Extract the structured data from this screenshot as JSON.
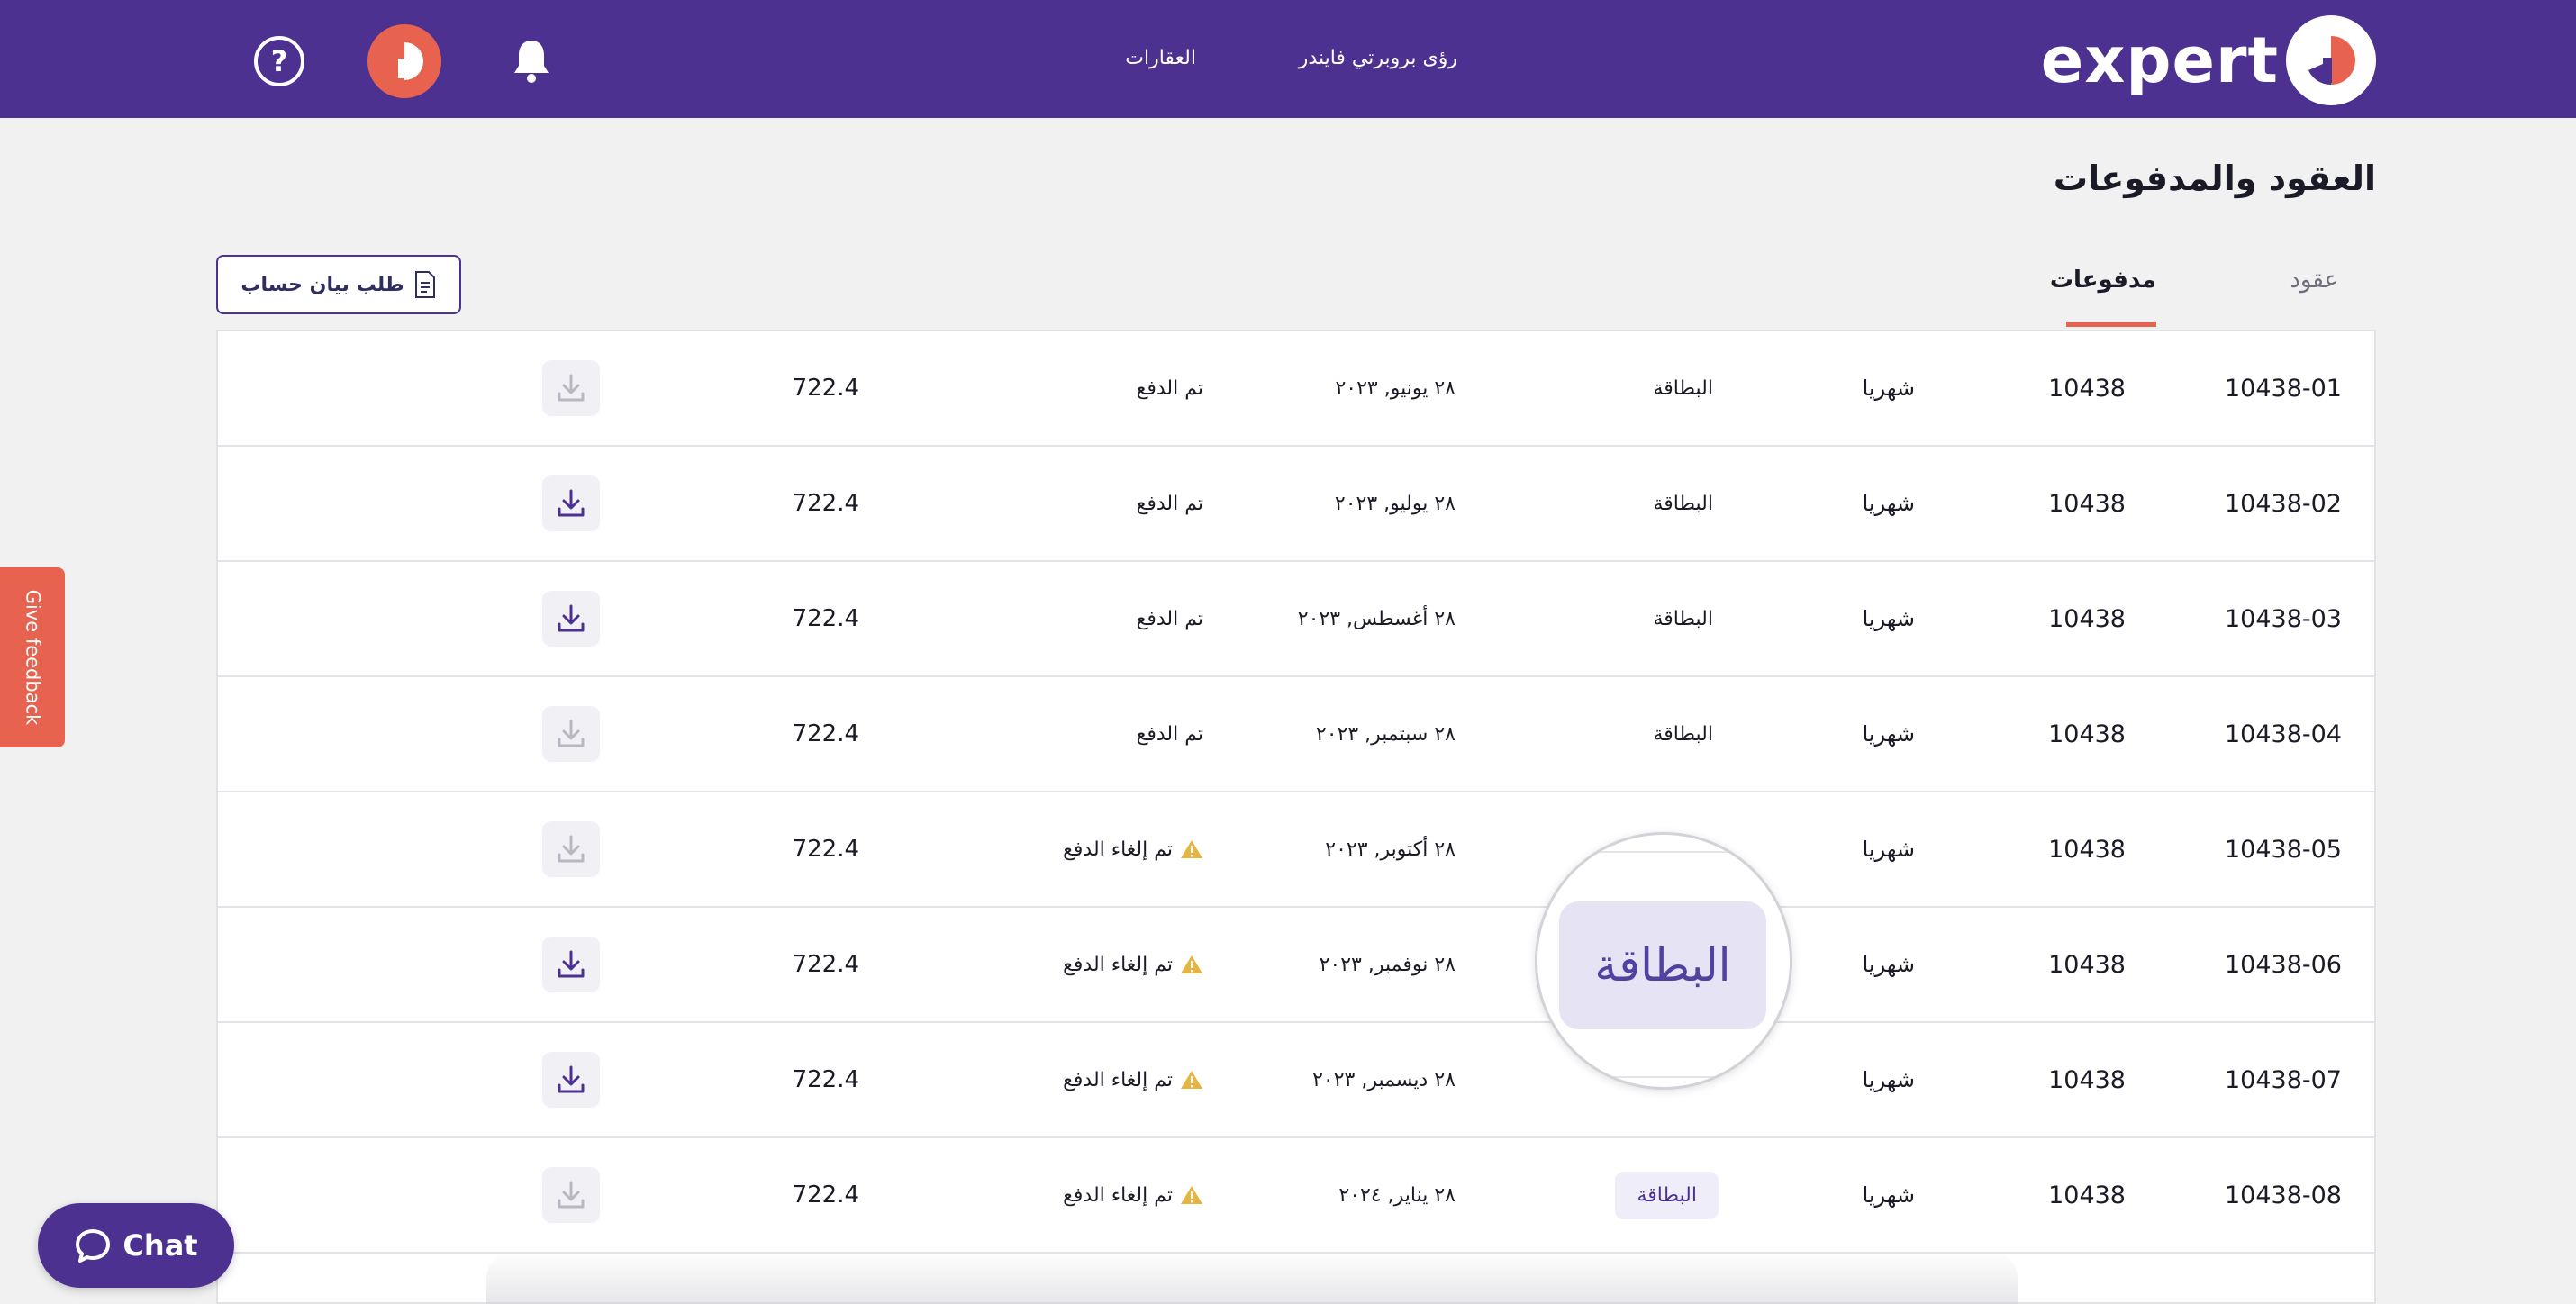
{
  "header": {
    "logo_text": "expert",
    "nav": [
      {
        "label": "رؤى بروبرتي فايندر"
      },
      {
        "label": "العقارات"
      }
    ],
    "icons": [
      "bell-icon",
      "avatar-logo-icon",
      "help-icon"
    ],
    "help_glyph": "?"
  },
  "page": {
    "title": "العقود والمدفوعات"
  },
  "tabs": [
    {
      "label": "عقود",
      "active": false
    },
    {
      "label": "مدفوعات",
      "active": true
    }
  ],
  "statement_button": {
    "label": "طلب بيان حساب",
    "icon": "document-icon"
  },
  "payments": {
    "rows": [
      {
        "id": "10438-01",
        "contract": "10438",
        "frequency": "شهريا",
        "method": "البطاقة",
        "method_badge": false,
        "date": "٢٨ يونيو, ٢٠٢٣",
        "status": "تم الدفع",
        "warning": false,
        "amount": "722.4",
        "download_enabled": false
      },
      {
        "id": "10438-02",
        "contract": "10438",
        "frequency": "شهريا",
        "method": "البطاقة",
        "method_badge": false,
        "date": "٢٨ يوليو, ٢٠٢٣",
        "status": "تم الدفع",
        "warning": false,
        "amount": "722.4",
        "download_enabled": true
      },
      {
        "id": "10438-03",
        "contract": "10438",
        "frequency": "شهريا",
        "method": "البطاقة",
        "method_badge": false,
        "date": "٢٨ أغسطس, ٢٠٢٣",
        "status": "تم الدفع",
        "warning": false,
        "amount": "722.4",
        "download_enabled": true
      },
      {
        "id": "10438-04",
        "contract": "10438",
        "frequency": "شهريا",
        "method": "البطاقة",
        "method_badge": false,
        "date": "٢٨ سبتمبر, ٢٠٢٣",
        "status": "تم الدفع",
        "warning": false,
        "amount": "722.4",
        "download_enabled": false
      },
      {
        "id": "10438-05",
        "contract": "10438",
        "frequency": "شهريا",
        "method": "",
        "method_badge": false,
        "date": "٢٨ أكتوبر, ٢٠٢٣",
        "status": "تم إلغاء الدفع",
        "warning": true,
        "amount": "722.4",
        "download_enabled": false
      },
      {
        "id": "10438-06",
        "contract": "10438",
        "frequency": "شهريا",
        "method": "",
        "method_badge": false,
        "date": "٢٨ نوفمبر, ٢٠٢٣",
        "status": "تم إلغاء الدفع",
        "warning": true,
        "amount": "722.4",
        "download_enabled": true
      },
      {
        "id": "10438-07",
        "contract": "10438",
        "frequency": "شهريا",
        "method": "",
        "method_badge": false,
        "date": "٢٨ ديسمبر, ٢٠٢٣",
        "status": "تم إلغاء الدفع",
        "warning": true,
        "amount": "722.4",
        "download_enabled": true
      },
      {
        "id": "10438-08",
        "contract": "10438",
        "frequency": "شهريا",
        "method": "البطاقة",
        "method_badge": true,
        "date": "٢٨ يناير, ٢٠٢٤",
        "status": "تم إلغاء الدفع",
        "warning": true,
        "amount": "722.4",
        "download_enabled": false
      }
    ]
  },
  "zoom_callout": {
    "label": "البطاقة"
  },
  "feedback": {
    "label": "Give feedback"
  },
  "chat": {
    "label": "Chat",
    "icon": "chat-bubble-icon"
  },
  "colors": {
    "brand": "#4d3191",
    "accent": "#e8634f",
    "background": "#f1f1f1",
    "warning": "#e5b443",
    "download_active": "#4d3191",
    "download_disabled": "#b8b8c2"
  }
}
